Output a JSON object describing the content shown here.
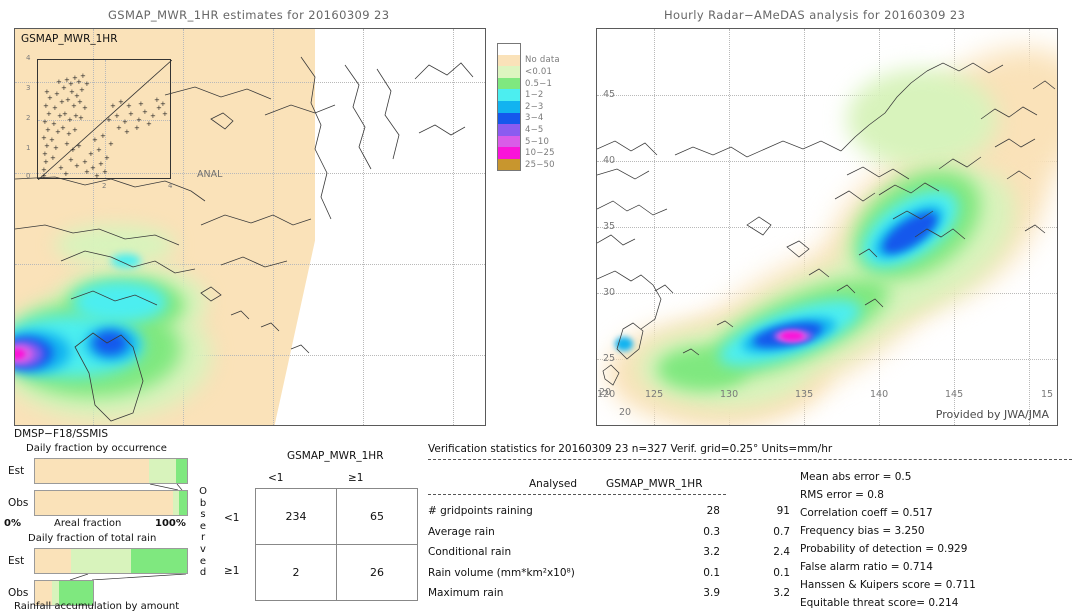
{
  "left_panel": {
    "title": "GSMAP_MWR_1HR estimates for 20160309 23",
    "overlay_label": "GSMAP_MWR_1HR",
    "inset": {
      "x_ticks": [
        "0",
        "2",
        "4"
      ],
      "y_ticks": [
        "0",
        "1",
        "2",
        "3",
        "4"
      ],
      "corner_label": "ANAL"
    },
    "footer": "DMSP−F18/SSMIS"
  },
  "right_panel": {
    "title": "Hourly Radar−AMeDAS analysis for 20160309 23",
    "credit": "Provided by JWA/JMA",
    "x_ticks": [
      "120",
      "125",
      "130",
      "135",
      "140",
      "145",
      "15"
    ],
    "y_ticks": [
      "45",
      "40",
      "35",
      "30",
      "25",
      "20"
    ],
    "lower_left_label": "20"
  },
  "colorbar": {
    "entries": [
      {
        "label": "",
        "color": "#ffffff"
      },
      {
        "label": "No data",
        "color": "#fae2b9"
      },
      {
        "label": "<0.01",
        "color": "#ddf5c0"
      },
      {
        "label": "0.5−1",
        "color": "#7fe87f"
      },
      {
        "label": "1−2",
        "color": "#4ceef0"
      },
      {
        "label": "2−3",
        "color": "#12b3f0"
      },
      {
        "label": "3−4",
        "color": "#1558ec"
      },
      {
        "label": "4−5",
        "color": "#8b5cf0"
      },
      {
        "label": "5−10",
        "color": "#d95ce8"
      },
      {
        "label": "10−25",
        "color": "#fa14d8"
      },
      {
        "label": "25−50",
        "color": "#c8962e"
      }
    ]
  },
  "fraction_charts": {
    "occurrence": {
      "title": "Daily fraction by occurrence",
      "rows": [
        {
          "label": "Est",
          "segments": [
            75,
            18,
            7
          ]
        },
        {
          "label": "Obs",
          "segments": [
            91,
            4,
            5
          ]
        }
      ],
      "axis_left": "0%",
      "axis_center": "Areal fraction",
      "axis_right": "100%"
    },
    "total_rain": {
      "title": "Daily fraction of total rain",
      "rows": [
        {
          "label": "Est",
          "segments": [
            24,
            39,
            37
          ],
          "width_pct": 100
        },
        {
          "label": "Obs",
          "segments": [
            29,
            13,
            58
          ],
          "width_pct": 39
        }
      ],
      "caption": "Rainfall accumulation by amount"
    },
    "segment_colors": [
      "#fae2b9",
      "#d8f3bc",
      "#7fe87f"
    ]
  },
  "contingency": {
    "title": "GSMAP_MWR_1HR",
    "col_headers": [
      "<1",
      "≥1"
    ],
    "row_headers": [
      "<1",
      "≥1"
    ],
    "side_label": "Observed",
    "cells": [
      [
        "234",
        "65"
      ],
      [
        "2",
        "26"
      ]
    ]
  },
  "verification": {
    "header": "Verification statistics for 20160309 23  n=327  Verif. grid=0.25°  Units=mm/hr",
    "rule": "−−−−−−−−−−−−−−−−−−−−−−−−−−−−−−−−−−−−−−−−−−−−−−−−−−−−−−−−−−−−−−−−",
    "col_headers": [
      "Analysed",
      "GSMAP_MWR_1HR"
    ],
    "subrule": "−−−−−−−−−−−−−−−−−−−−−−−−−−−−−−−−−−−−",
    "rows": [
      {
        "name": "# gridpoints raining",
        "analysed": "28",
        "model": "91"
      },
      {
        "name": "Average rain",
        "analysed": "0.3",
        "model": "0.7"
      },
      {
        "name": "Conditional rain",
        "analysed": "3.2",
        "model": "2.4"
      },
      {
        "name": "Rain volume (mm*km²x10⁸)",
        "analysed": "0.1",
        "model": "0.1"
      },
      {
        "name": "Maximum rain",
        "analysed": "3.9",
        "model": "3.2"
      }
    ],
    "scores": [
      "Mean abs error = 0.5",
      "RMS error = 0.8",
      "Correlation coeff = 0.517",
      "Frequency bias = 3.250",
      "Probability of detection = 0.929",
      "False alarm ratio = 0.714",
      "Hanssen & Kuipers score = 0.711",
      "Equitable threat score= 0.214"
    ]
  }
}
